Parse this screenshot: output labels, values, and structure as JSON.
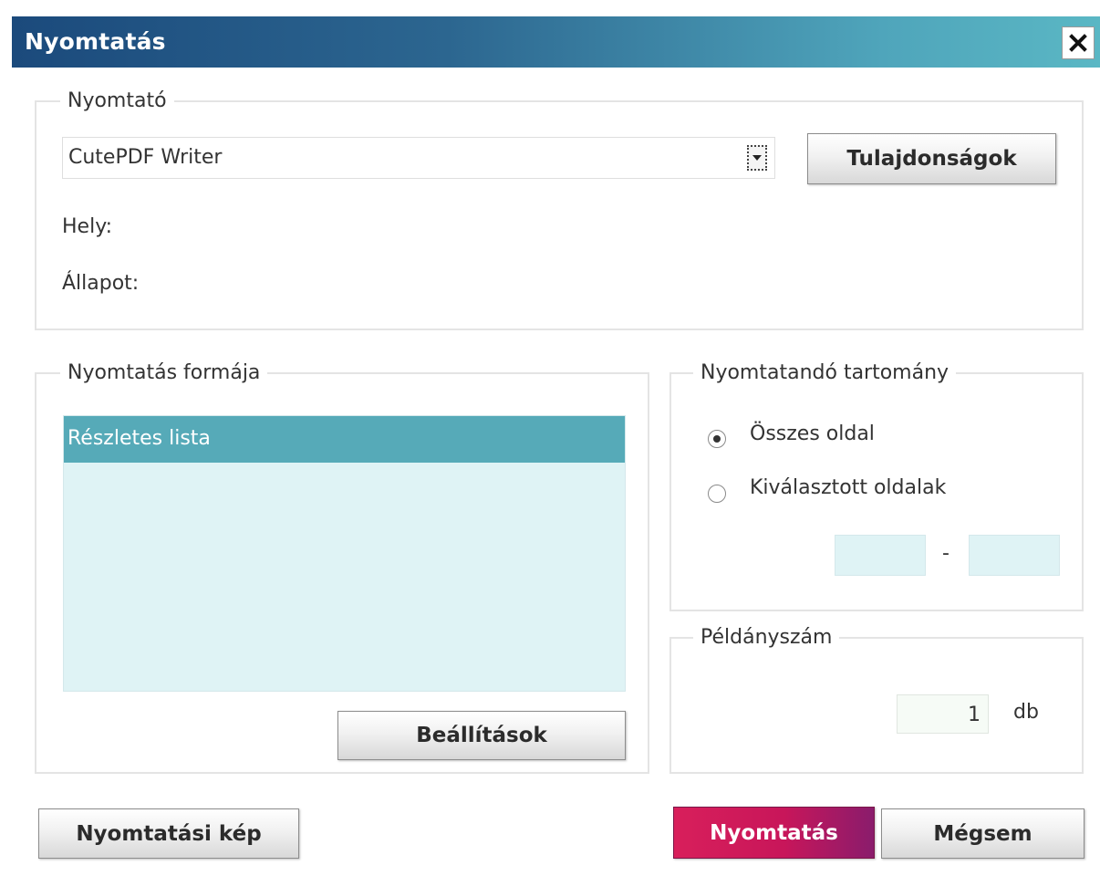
{
  "window": {
    "title": "Nyomtatás",
    "close_symbol": "✕"
  },
  "printer": {
    "legend": "Nyomtató",
    "selected": "CutePDF Writer",
    "properties_button": "Tulajdonságok",
    "location_label": "Hely:",
    "status_label": "Állapot:"
  },
  "format": {
    "legend": "Nyomtatás formája",
    "items": [
      "Részletes lista"
    ],
    "settings_button": "Beállítások"
  },
  "range": {
    "legend": "Nyomtatandó tartomány",
    "all_pages": "Összes oldal",
    "selected_pages": "Kiválasztott oldalak",
    "separator": "-",
    "from_value": "",
    "to_value": ""
  },
  "copies": {
    "legend": "Példányszám",
    "value": "1",
    "unit": "db"
  },
  "footer": {
    "preview_button": "Nyomtatási kép",
    "print_button": "Nyomtatás",
    "cancel_button": "Mégsem"
  },
  "colors": {
    "title_gradient_start": "#1b4a7c",
    "title_gradient_end": "#5ab7c4",
    "selection": "#56aab8",
    "list_background": "#dff3f5",
    "primary_button": "#c8165a"
  }
}
